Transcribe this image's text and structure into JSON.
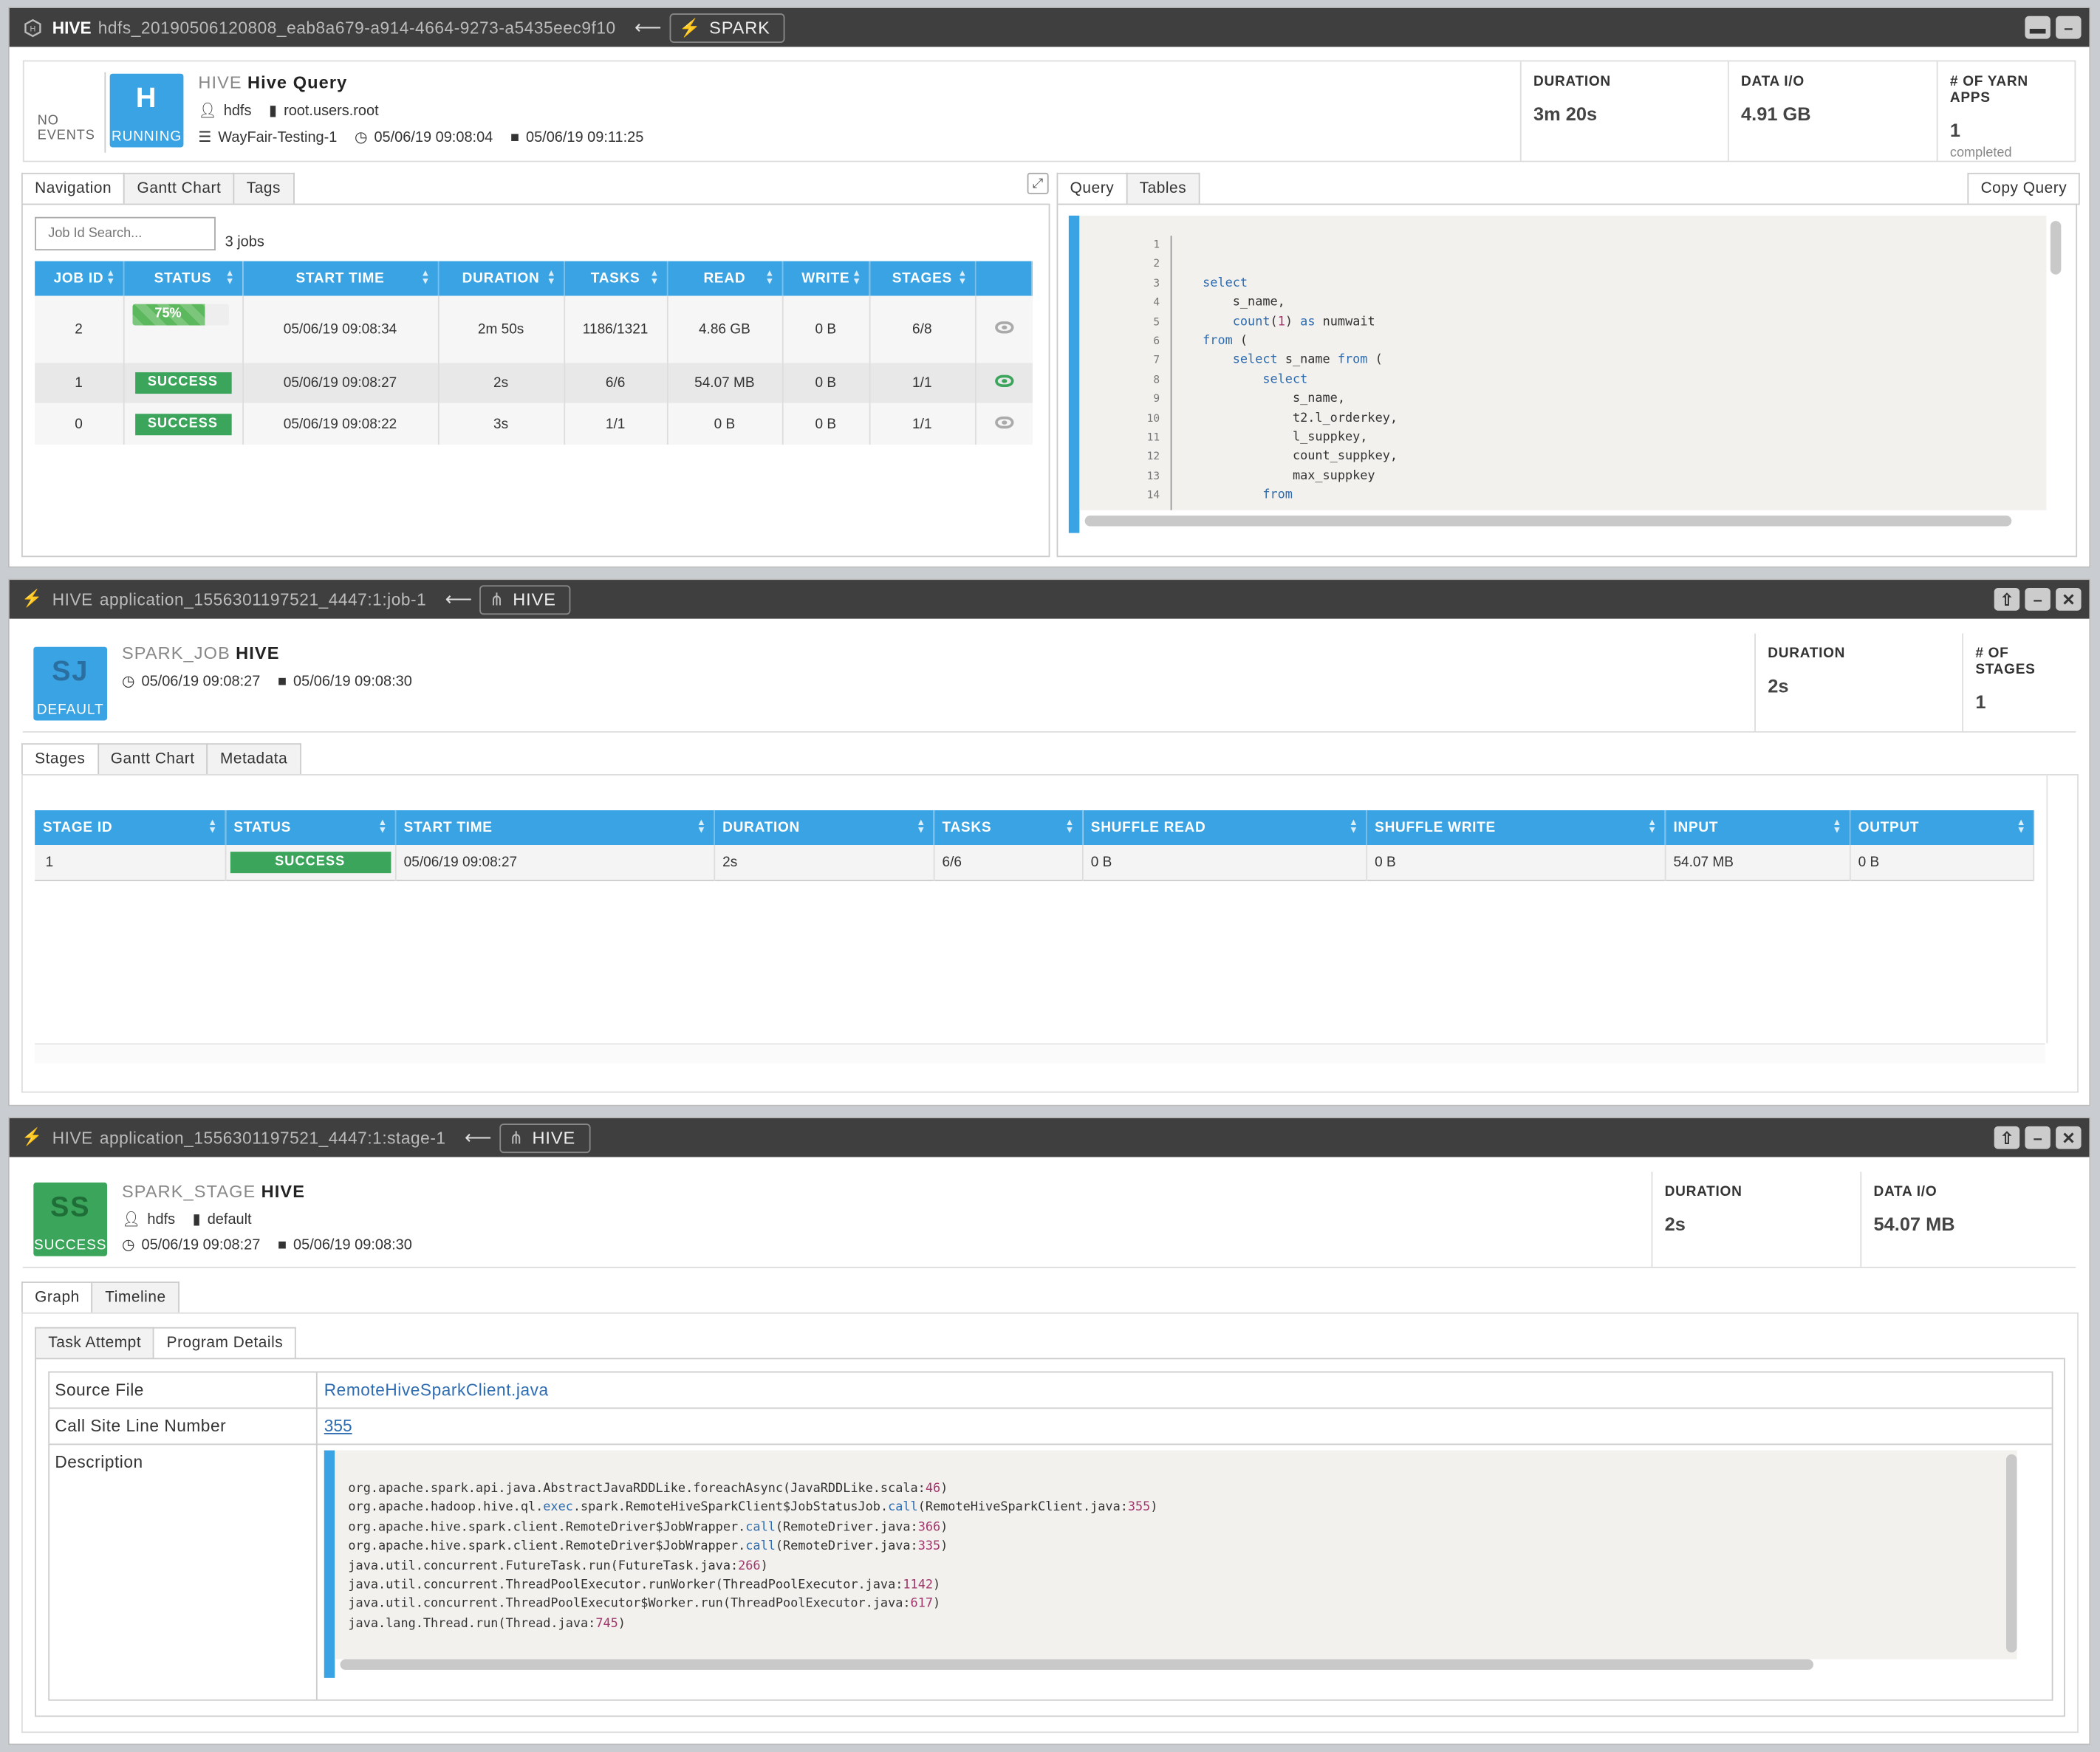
{
  "p1": {
    "title_app": "HIVE",
    "title_id": "hdfs_20190506120808_eab8a679-a914-4664-9273-a5435eec9f10",
    "link_label": "SPARK",
    "no_events": "NO EVENTS",
    "badge_letter": "H",
    "badge_status": "RUNNING",
    "kind": "HIVE",
    "name": "Hive Query",
    "user": "hdfs",
    "queue": "root.users.root",
    "cluster": "WayFair-Testing-1",
    "start": "05/06/19 09:08:04",
    "end": "05/06/19 09:11:25",
    "stats": [
      {
        "label": "DURATION",
        "value": "3m 20s",
        "sub": ""
      },
      {
        "label": "DATA I/O",
        "value": "4.91 GB",
        "sub": ""
      },
      {
        "label": "# OF YARN APPS",
        "value": "1",
        "sub": "completed"
      }
    ],
    "left_tabs": [
      "Navigation",
      "Gantt Chart",
      "Tags"
    ],
    "right_tabs": [
      "Query",
      "Tables"
    ],
    "copy_query": "Copy Query",
    "search_placeholder": "Job Id Search...",
    "job_count": "3 jobs",
    "job_columns": [
      "JOB ID",
      "STATUS",
      "START TIME",
      "DURATION",
      "TASKS",
      "READ",
      "WRITE",
      "STAGES"
    ],
    "jobs": [
      {
        "id": "2",
        "status": "75%",
        "start": "05/06/19 09:08:34",
        "duration": "2m 50s",
        "tasks": "1186/1321",
        "read": "4.86 GB",
        "write": "0 B",
        "stages": "6/8"
      },
      {
        "id": "1",
        "status": "SUCCESS",
        "start": "05/06/19 09:08:27",
        "duration": "2s",
        "tasks": "6/6",
        "read": "54.07 MB",
        "write": "0 B",
        "stages": "1/1"
      },
      {
        "id": "0",
        "status": "SUCCESS",
        "start": "05/06/19 09:08:22",
        "duration": "3s",
        "tasks": "1/1",
        "read": "0 B",
        "write": "0 B",
        "stages": "1/1"
      }
    ],
    "job2_progress": 0.75,
    "query_lines": [
      "",
      "",
      "select",
      "    s_name,",
      "    count(1) as numwait",
      "from (",
      "    select s_name from (",
      "        select",
      "            s_name,",
      "            t2.l_orderkey,",
      "            l_suppkey,",
      "            count_suppkey,",
      "            max_suppkey",
      "        from"
    ]
  },
  "p2": {
    "title_app": "HIVE",
    "title_id": "application_1556301197521_4447:1:job-1",
    "link_label": "HIVE",
    "badge_letter": "SJ",
    "badge_status": "DEFAULT",
    "kind": "SPARK_JOB",
    "name": "HIVE",
    "start": "05/06/19 09:08:27",
    "end": "05/06/19 09:08:30",
    "stats": [
      {
        "label": "DURATION",
        "value": "2s"
      },
      {
        "label": "# OF STAGES",
        "value": "1"
      }
    ],
    "tabs": [
      "Stages",
      "Gantt Chart",
      "Metadata"
    ],
    "columns": [
      "STAGE ID",
      "STATUS",
      "START TIME",
      "DURATION",
      "TASKS",
      "SHUFFLE READ",
      "SHUFFLE WRITE",
      "INPUT",
      "OUTPUT"
    ],
    "row": [
      "1",
      "SUCCESS",
      "05/06/19 09:08:27",
      "2s",
      "6/6",
      "0 B",
      "0 B",
      "54.07 MB",
      "0 B"
    ]
  },
  "p3": {
    "title_app": "HIVE",
    "title_id": "application_1556301197521_4447:1:stage-1",
    "link_label": "HIVE",
    "badge_letter": "SS",
    "badge_status": "SUCCESS",
    "kind": "SPARK_STAGE",
    "name": "HIVE",
    "user": "hdfs",
    "queue": "default",
    "start": "05/06/19 09:08:27",
    "end": "05/06/19 09:08:30",
    "stats": [
      {
        "label": "DURATION",
        "value": "2s"
      },
      {
        "label": "DATA I/O",
        "value": "54.07 MB"
      }
    ],
    "tabs": [
      "Graph",
      "Timeline"
    ],
    "subtabs": [
      "Task Attempt",
      "Program Details"
    ],
    "source_label": "Source File",
    "source_value": "RemoteHiveSparkClient.java",
    "line_label": "Call Site Line Number",
    "line_value": "355",
    "desc_label": "Description",
    "desc_lines": [
      "org.apache.spark.api.java.AbstractJavaRDDLike.foreachAsync(JavaRDDLike.scala:46)",
      "org.apache.hadoop.hive.ql.exec.spark.RemoteHiveSparkClient$JobStatusJob.call(RemoteHiveSparkClient.java:355)",
      "org.apache.hive.spark.client.RemoteDriver$JobWrapper.call(RemoteDriver.java:366)",
      "org.apache.hive.spark.client.RemoteDriver$JobWrapper.call(RemoteDriver.java:335)",
      "java.util.concurrent.FutureTask.run(FutureTask.java:266)",
      "java.util.concurrent.ThreadPoolExecutor.runWorker(ThreadPoolExecutor.java:1142)",
      "java.util.concurrent.ThreadPoolExecutor$Worker.run(ThreadPoolExecutor.java:617)",
      "java.lang.Thread.run(Thread.java:745)"
    ]
  },
  "colors": {
    "titlebar": "#3f3f3f",
    "blue": "#3aa3e3",
    "green": "#3ba55c"
  }
}
